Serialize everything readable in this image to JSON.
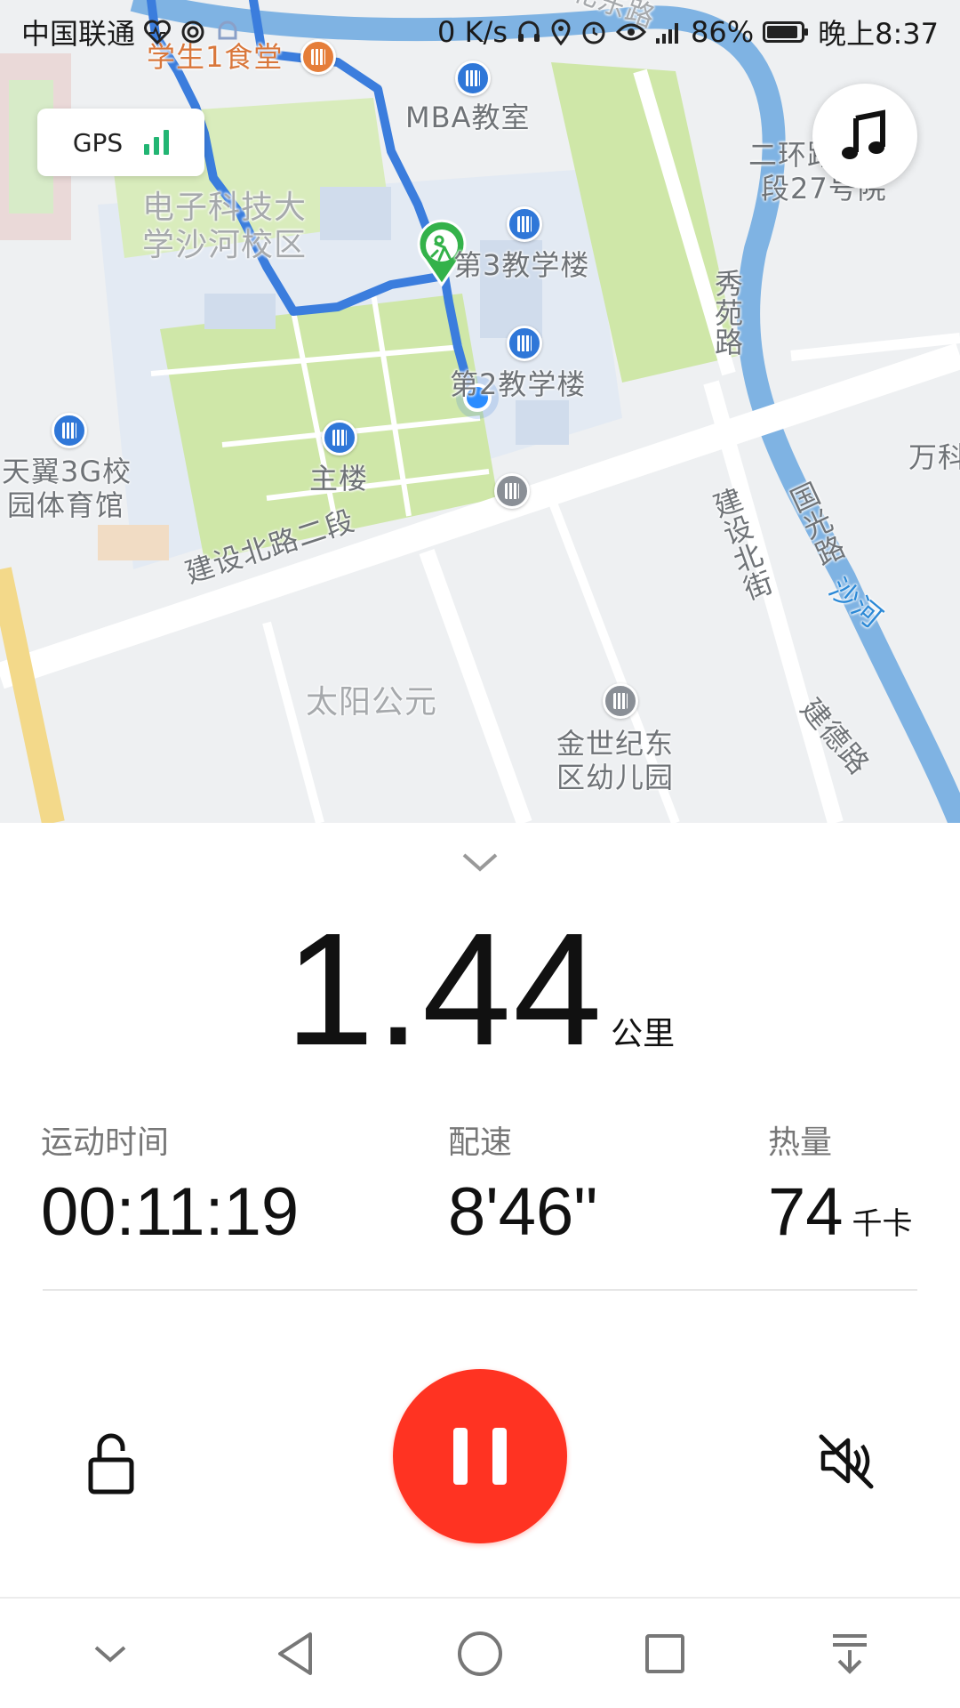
{
  "status_bar": {
    "carrier": "中国联通",
    "network_speed": "0 K/s",
    "battery_percent": "86%",
    "time": "晚上8:37",
    "icons": [
      "heart-rate-icon",
      "swirl-icon",
      "bell-icon",
      "headset-icon",
      "location-icon",
      "alarm-icon",
      "eye-icon",
      "signal-icon",
      "battery-icon"
    ]
  },
  "map": {
    "gps_label": "GPS",
    "gps_signal_bars": 3,
    "labels": {
      "canteen": "学生1食堂",
      "mba": "MBA教室",
      "campus_line1": "电子科技大",
      "campus_line2": "学沙河校区",
      "building3": "第3教学楼",
      "building2": "第2教学楼",
      "gym_line1": "天翼3G校",
      "gym_line2": "园体育馆",
      "main_building": "主楼",
      "road_jianshe": "建设北路二段",
      "road_xiuyuan": "秀苑路",
      "ring_line1": "二环路北一",
      "ring_line2": "段27号院",
      "taiyang": "太阳公元",
      "kindergarten_line1": "金世纪东",
      "kindergarten_line2": "区幼儿园",
      "jianshe_street": "建设北街",
      "guoguang": "国光路",
      "shahe": "沙河",
      "jiande": "建德路",
      "wanke": "万科",
      "north_road": "北东路"
    },
    "route_color": "#3b7ddd",
    "start_marker_color": "#34b24a"
  },
  "stats": {
    "distance_value": "1.44",
    "distance_unit": "公里",
    "time_label": "运动时间",
    "time_value": "00:11:19",
    "pace_label": "配速",
    "pace_value": "8'46\"",
    "calorie_label": "热量",
    "calorie_value": "74",
    "calorie_unit": "千卡"
  },
  "controls": {
    "pause_color": "#ff3322"
  }
}
